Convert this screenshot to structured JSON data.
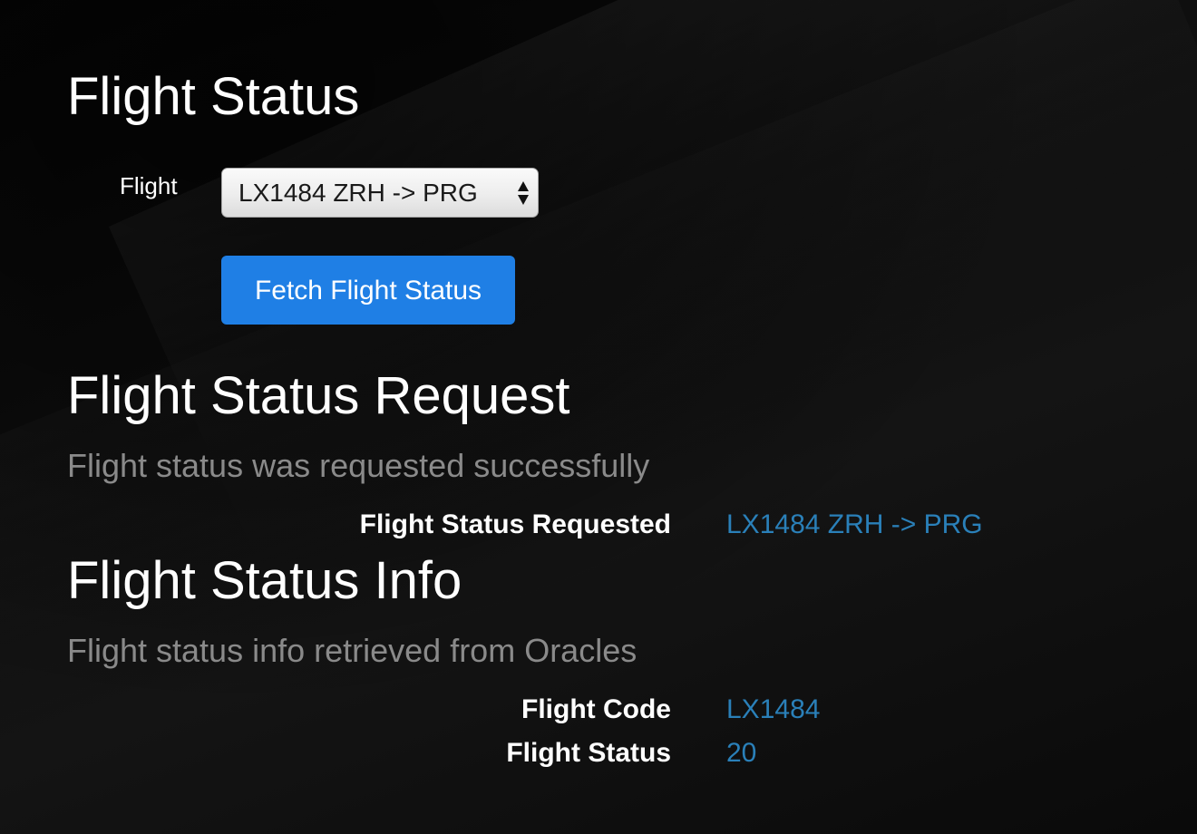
{
  "page": {
    "title": "Flight Status"
  },
  "form": {
    "flight_label": "Flight",
    "flight_select_value": "LX1484 ZRH -> PRG",
    "fetch_button_label": "Fetch Flight Status"
  },
  "request_section": {
    "title": "Flight Status Request",
    "subtitle": "Flight status was requested successfully",
    "rows": [
      {
        "key": "Flight Status Requested",
        "value": "LX1484 ZRH -> PRG"
      }
    ]
  },
  "info_section": {
    "title": "Flight Status Info",
    "subtitle": "Flight status info retrieved from Oracles",
    "rows": [
      {
        "key": "Flight Code",
        "value": "LX1484"
      },
      {
        "key": "Flight Status",
        "value": "20"
      }
    ]
  },
  "colors": {
    "button_bg": "#1f7fe5",
    "value_text": "#2a80b9",
    "subtitle_text": "#8a8a8a",
    "background": "#0b0b0b"
  },
  "icons": {
    "select_arrows": "updown-arrows-icon"
  }
}
